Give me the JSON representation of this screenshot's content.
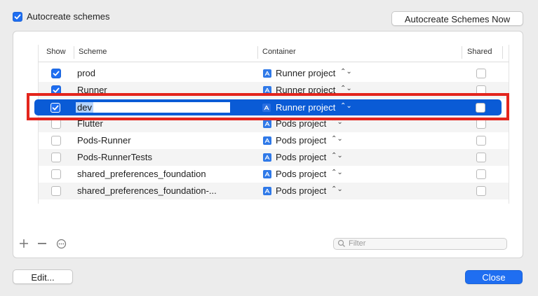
{
  "header": {
    "autocreate_label": "Autocreate schemes",
    "autocreate_checked": true,
    "autocreate_now_button": "Autocreate Schemes Now"
  },
  "table": {
    "columns": [
      "Show",
      "Scheme",
      "Container",
      "Shared"
    ],
    "rows": [
      {
        "show": true,
        "scheme": "prod",
        "container": "Runner project",
        "shared": false
      },
      {
        "show": true,
        "scheme": "Runner",
        "container": "Runner project",
        "shared": false
      },
      {
        "show": true,
        "scheme": "dev",
        "container": "Runner project",
        "shared": false,
        "selected": true,
        "editing": true
      },
      {
        "show": false,
        "scheme": "Flutter",
        "container": "Pods project",
        "shared": false
      },
      {
        "show": false,
        "scheme": "Pods-Runner",
        "container": "Pods project",
        "shared": false
      },
      {
        "show": false,
        "scheme": "Pods-RunnerTests",
        "container": "Pods project",
        "shared": false
      },
      {
        "show": false,
        "scheme": "shared_preferences_foundation",
        "container": "Pods project",
        "shared": false
      },
      {
        "show": false,
        "scheme": "shared_preferences_foundation-...",
        "container": "Pods project",
        "shared": false
      }
    ]
  },
  "toolbar": {
    "add_icon": "plus-icon",
    "remove_icon": "minus-icon",
    "more_icon": "ellipsis-circle-icon",
    "filter_placeholder": "Filter"
  },
  "footer": {
    "edit_button": "Edit...",
    "close_button": "Close"
  },
  "colors": {
    "accent": "#1f6ef1",
    "selection": "#0a5bd6",
    "annotation": "#e3251d"
  }
}
